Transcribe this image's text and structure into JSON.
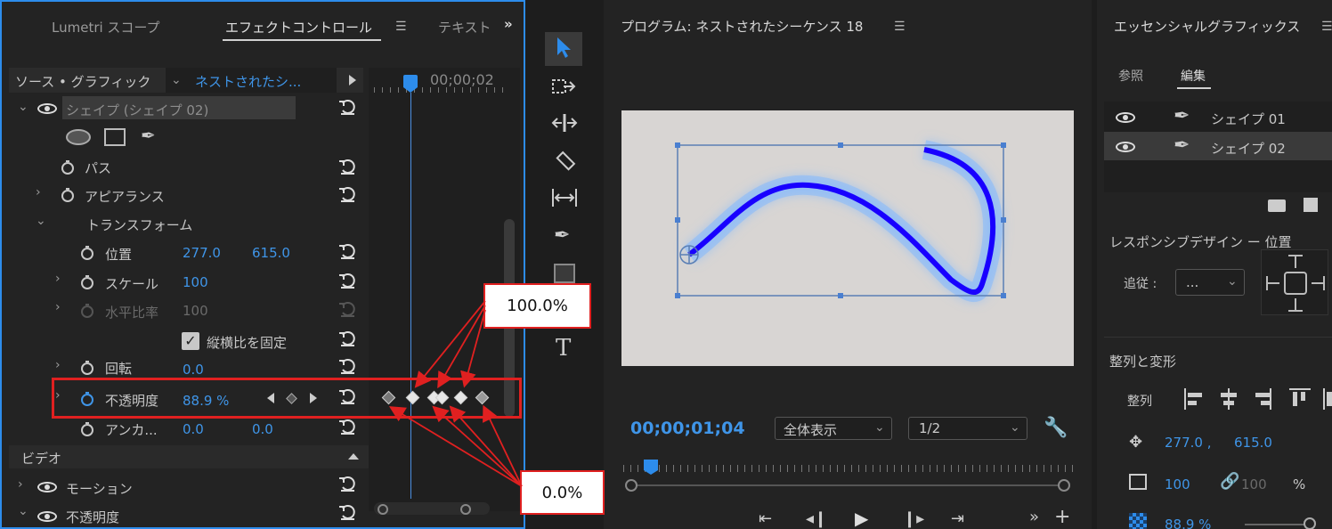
{
  "left_panel": {
    "tabs": [
      "Lumetri スコープ",
      "エフェクトコントロール",
      "テキスト"
    ],
    "tab_more": "»",
    "source_label": "ソース • グラフィック",
    "sequence_label": "ネストされたシ...",
    "timecode": "00;00;02",
    "shape_layer": "シェイプ (シェイプ 02)",
    "path_label": "パス",
    "appearance_label": "アピアランス",
    "transform_label": "トランスフォーム",
    "position_label": "位置",
    "position_x": "277.0",
    "position_y": "615.0",
    "scale_label": "スケール",
    "scale_value": "100",
    "hscale_label": "水平比率",
    "hscale_value": "100",
    "uniform_label": "縦横比を固定",
    "rotation_label": "回転",
    "rotation_value": "0.0",
    "opacity_label": "不透明度",
    "opacity_value": "88.9 %",
    "anchor_label": "アンカ...",
    "anchor_x": "0.0",
    "anchor_y": "0.0",
    "video_section": "ビデオ",
    "motion_label": "モーション",
    "opacity2_label": "不透明度"
  },
  "program": {
    "title": "プログラム: ネストされたシーケンス 18",
    "timecode": "00;00;01;04",
    "zoom_select": "全体表示",
    "resolution_select": "1/2"
  },
  "essential_graphics": {
    "title": "エッセンシャルグラフィックス",
    "tab_browse": "参照",
    "tab_edit": "編集",
    "layers": [
      "シェイプ 01",
      "シェイプ 02"
    ],
    "responsive_label": "レスポンシブデザイン ー 位置",
    "follow_label": "追従 :",
    "follow_value": "...",
    "align_label": "整列と変形",
    "align_sub": "整列",
    "pos_x": "277.0 ,",
    "pos_y": "615.0",
    "scale": "100",
    "scale_h": "100",
    "percent": "%",
    "opacity": "88.9 %"
  },
  "annotations": {
    "top": "100.0%",
    "bottom": "0.0%"
  },
  "colors": {
    "accent": "#2d8ceb",
    "annotation": "#e02020",
    "stroke": "#1800ff"
  }
}
